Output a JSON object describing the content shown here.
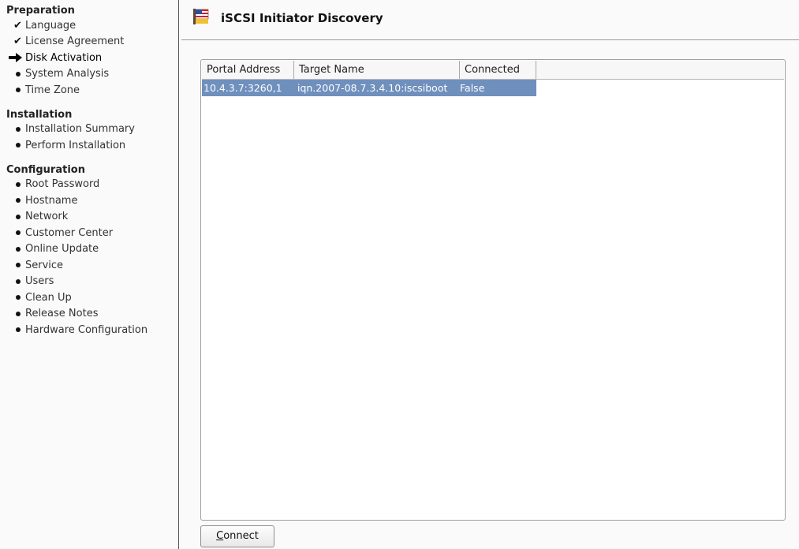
{
  "sidebar": {
    "sections": [
      {
        "heading": "Preparation",
        "items": [
          {
            "label": "Language",
            "state": "done"
          },
          {
            "label": "License Agreement",
            "state": "done"
          },
          {
            "label": "Disk Activation",
            "state": "current"
          },
          {
            "label": "System Analysis",
            "state": "pending"
          },
          {
            "label": "Time Zone",
            "state": "pending"
          }
        ]
      },
      {
        "heading": "Installation",
        "items": [
          {
            "label": "Installation Summary",
            "state": "pending"
          },
          {
            "label": "Perform Installation",
            "state": "pending"
          }
        ]
      },
      {
        "heading": "Configuration",
        "items": [
          {
            "label": "Root Password",
            "state": "pending"
          },
          {
            "label": "Hostname",
            "state": "pending"
          },
          {
            "label": "Network",
            "state": "pending"
          },
          {
            "label": "Customer Center",
            "state": "pending"
          },
          {
            "label": "Online Update",
            "state": "pending"
          },
          {
            "label": "Service",
            "state": "pending"
          },
          {
            "label": "Users",
            "state": "pending"
          },
          {
            "label": "Clean Up",
            "state": "pending"
          },
          {
            "label": "Release Notes",
            "state": "pending"
          },
          {
            "label": "Hardware Configuration",
            "state": "pending"
          }
        ]
      }
    ]
  },
  "header": {
    "title": "iSCSI Initiator Discovery",
    "icon": "flag-icon"
  },
  "table": {
    "columns": [
      "Portal Address",
      "Target Name",
      "Connected"
    ],
    "rows": [
      [
        "10.4.3.7:3260,1",
        "iqn.2007-08.7.3.4.10:iscsiboot",
        "False"
      ]
    ]
  },
  "buttons": {
    "connect_prefix": "C",
    "connect_rest": "onnect"
  },
  "colors": {
    "selection": "#6f90bd",
    "sidebar_bg": "#fbfafb"
  }
}
